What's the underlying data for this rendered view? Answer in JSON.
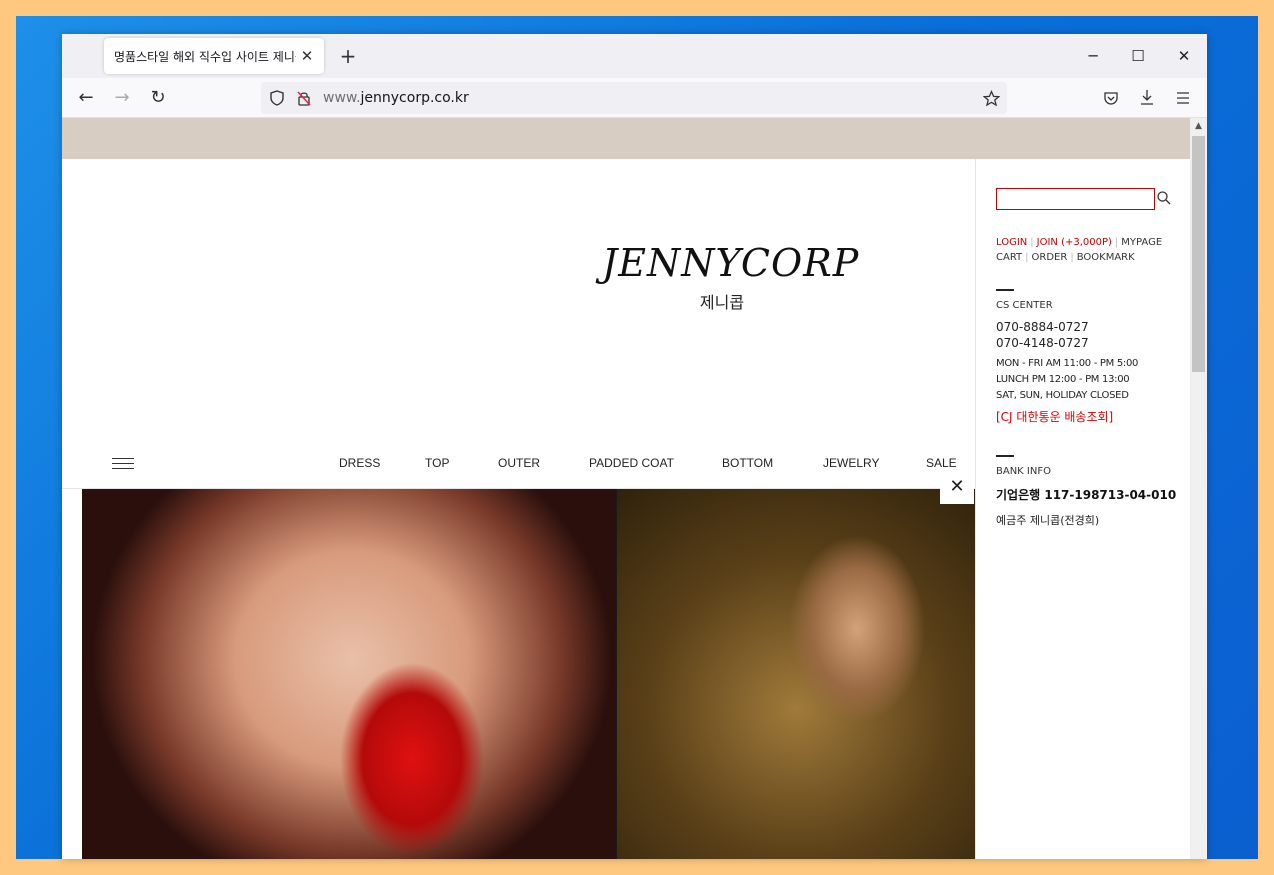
{
  "browser": {
    "tab_title": "명품스타일 해외 직수입 사이트 제니콥",
    "tab_close": "✕",
    "new_tab": "+",
    "url_prefix": "www.",
    "url_main": "jennycorp.co.kr",
    "controls": {
      "minimize": "─",
      "maximize": "☐",
      "close": "✕"
    },
    "nav": {
      "back": "←",
      "forward": "→",
      "reload": "↻"
    }
  },
  "site": {
    "logo": "JENNYCORP",
    "logo_sub": "제니콥",
    "menu": [
      "DRESS",
      "TOP",
      "OUTER",
      "PADDED COAT",
      "BOTTOM",
      "JEWELRY",
      "SALE"
    ],
    "hero_close": "✕"
  },
  "sidebar": {
    "login": "LOGIN",
    "join": "JOIN (+3,000P)",
    "mypage": "MYPAGE",
    "cart": "CART",
    "order": "ORDER",
    "bookmark": "BOOKMARK",
    "cs_title": "CS CENTER",
    "phone1": "070-8884-0727",
    "phone2": "070-4148-0727",
    "hours1": "MON - FRI    AM 11:00 - PM 5:00",
    "hours2": "LUNCH    PM 12:00 - PM 13:00",
    "hours3": "SAT, SUN, HOLIDAY CLOSED",
    "cj_link": "[CJ 대한통운 배송조회]",
    "bank_title": "BANK INFO",
    "bank_account": "기업은행   117-198713-04-010",
    "bank_holder": "예금주   제니콥(전경희)"
  }
}
